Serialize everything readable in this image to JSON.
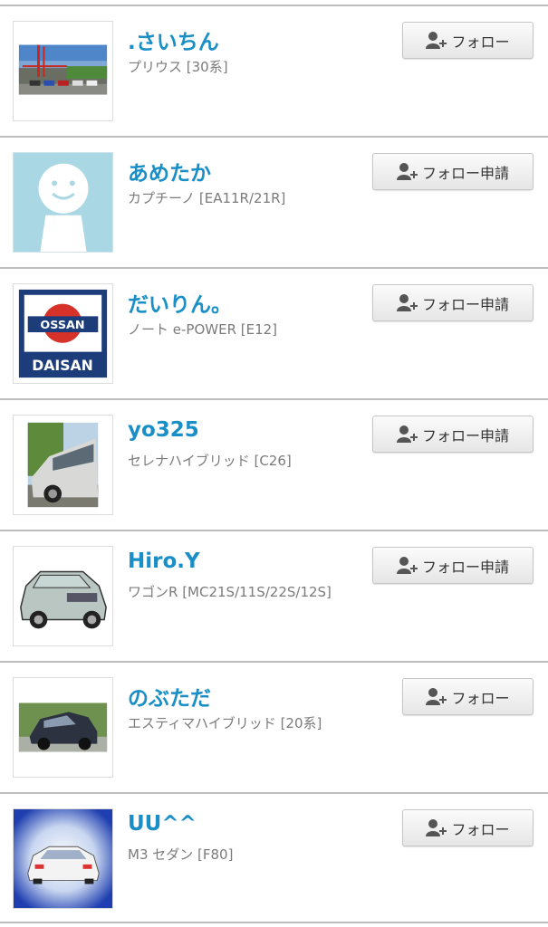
{
  "users": [
    {
      "name": ".さいちん",
      "car": "プリウス [30系]",
      "button": "フォロー",
      "kind": "follow",
      "avatar": "bridge-photo"
    },
    {
      "name": "あめたか",
      "car": "カプチーノ [EA11R/21R]",
      "button": "フォロー申請",
      "kind": "request",
      "avatar": "default-smiley"
    },
    {
      "name": "だいりん。",
      "car": "ノート e-POWER [E12]",
      "button": "フォロー申請",
      "kind": "request",
      "avatar": "ossan-daisan-logo",
      "avatar_text_top": "OSSAN",
      "avatar_text_bottom": "DAISAN"
    },
    {
      "name": "yo325",
      "car": "セレナハイブリッド [C26]",
      "button": "フォロー申請",
      "kind": "request",
      "avatar": "silver-minivan-photo"
    },
    {
      "name": "Hiro.Y",
      "car": "ワゴンR [MC21S/11S/22S/12S]",
      "button": "フォロー申請",
      "kind": "request",
      "avatar": "wagon-r-illustration"
    },
    {
      "name": "のぶただ",
      "car": "エスティマハイブリッド [20系]",
      "button": "フォロー",
      "kind": "follow",
      "avatar": "dark-minivan-photo"
    },
    {
      "name": "UU^^",
      "car": "M3 セダン [F80]",
      "button": "フォロー",
      "kind": "follow",
      "avatar": "white-car-blue-bg"
    }
  ],
  "colors": {
    "name": "#1a8fc7",
    "subtext": "#7b7b7b",
    "divider": "#bdbdbd",
    "button_text": "#333333"
  },
  "icons": {
    "follow_button": "person-add-icon"
  }
}
